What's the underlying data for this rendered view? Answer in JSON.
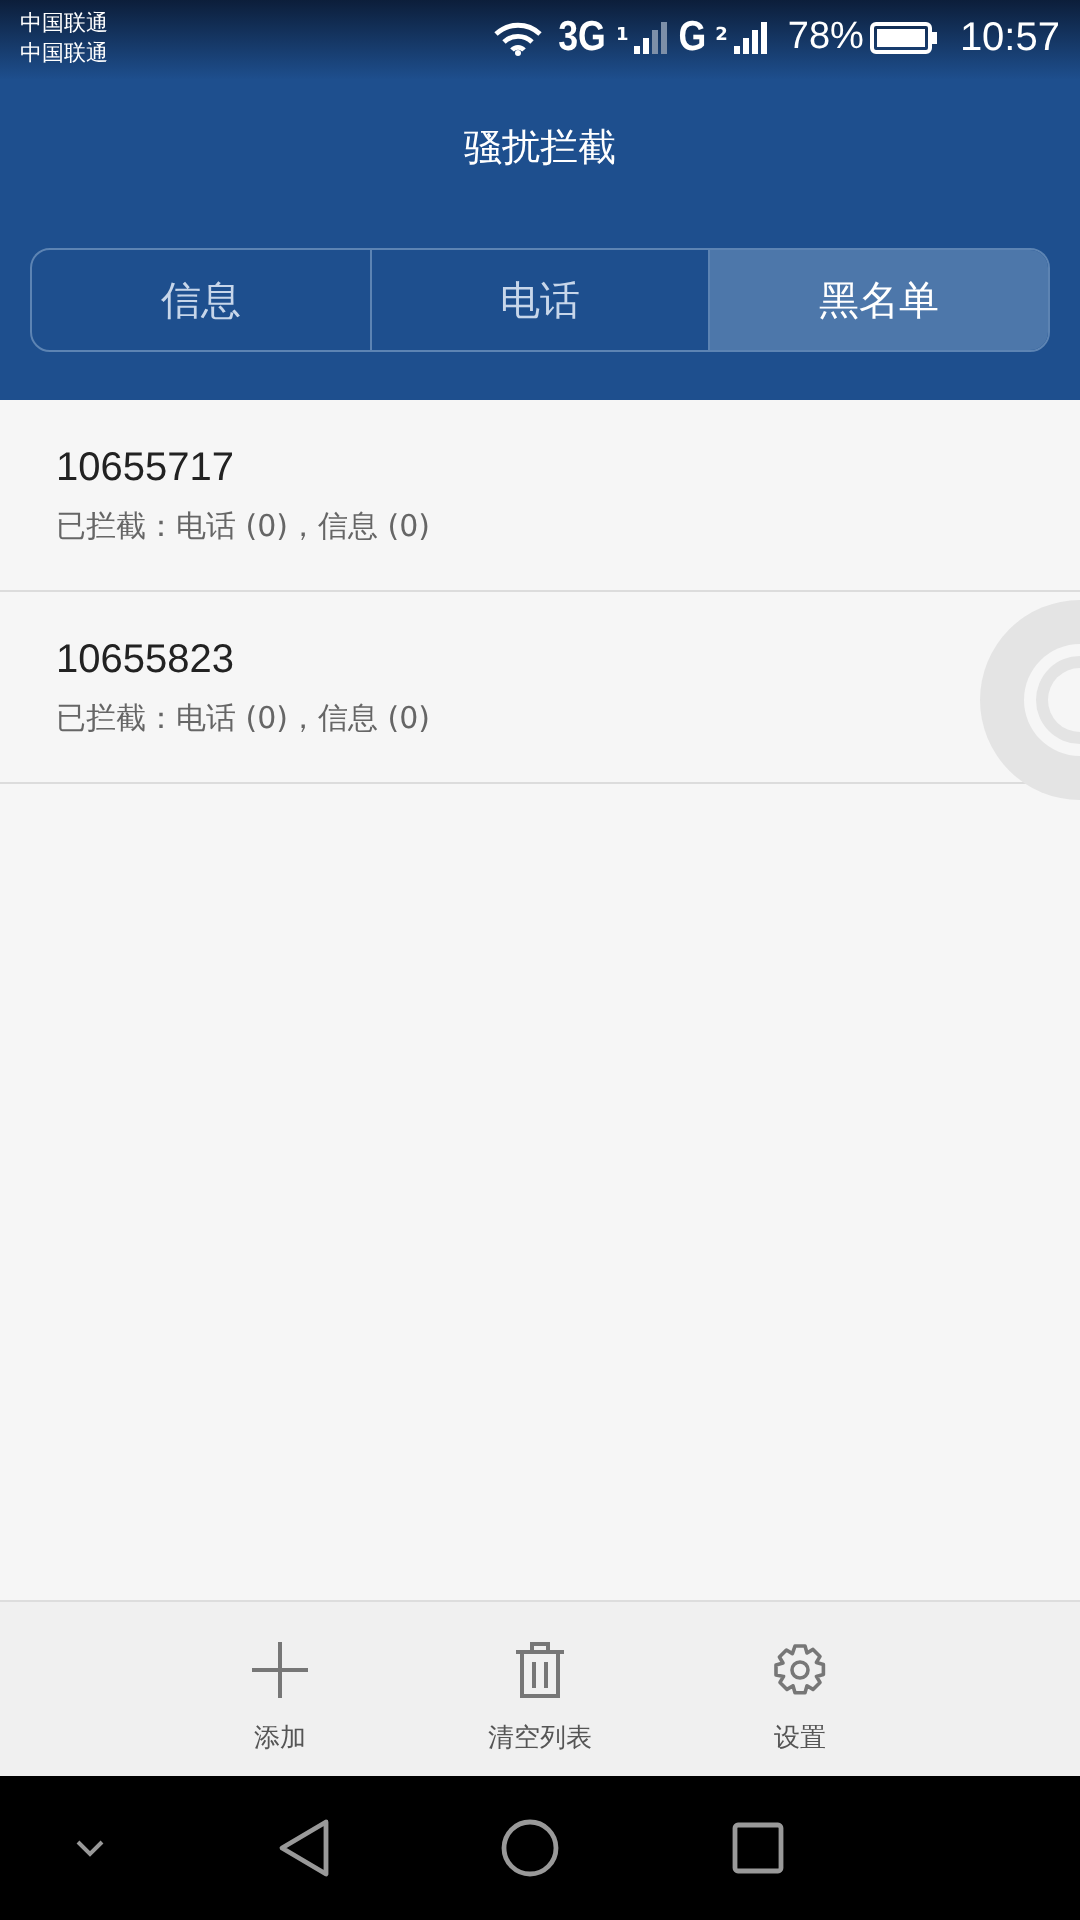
{
  "status_bar": {
    "carriers": [
      "中国联通",
      "中国联通"
    ],
    "sims": [
      {
        "network": "3G",
        "slot": "1"
      },
      {
        "network": "G",
        "slot": "2"
      }
    ],
    "battery": "78%",
    "time": "10:57"
  },
  "title": "骚扰拦截",
  "tabs": [
    {
      "label": "信息",
      "selected": false
    },
    {
      "label": "电话",
      "selected": false
    },
    {
      "label": "黑名单",
      "selected": true
    }
  ],
  "entries": [
    {
      "number": "10655717",
      "summary": "已拦截：电话 (0)，信息 (0)"
    },
    {
      "number": "10655823",
      "summary": "已拦截：电话 (0)，信息 (0)"
    }
  ],
  "actions": [
    {
      "kind": "add",
      "label": "添加"
    },
    {
      "kind": "clear",
      "label": "清空列表"
    },
    {
      "kind": "settings",
      "label": "设置"
    }
  ]
}
